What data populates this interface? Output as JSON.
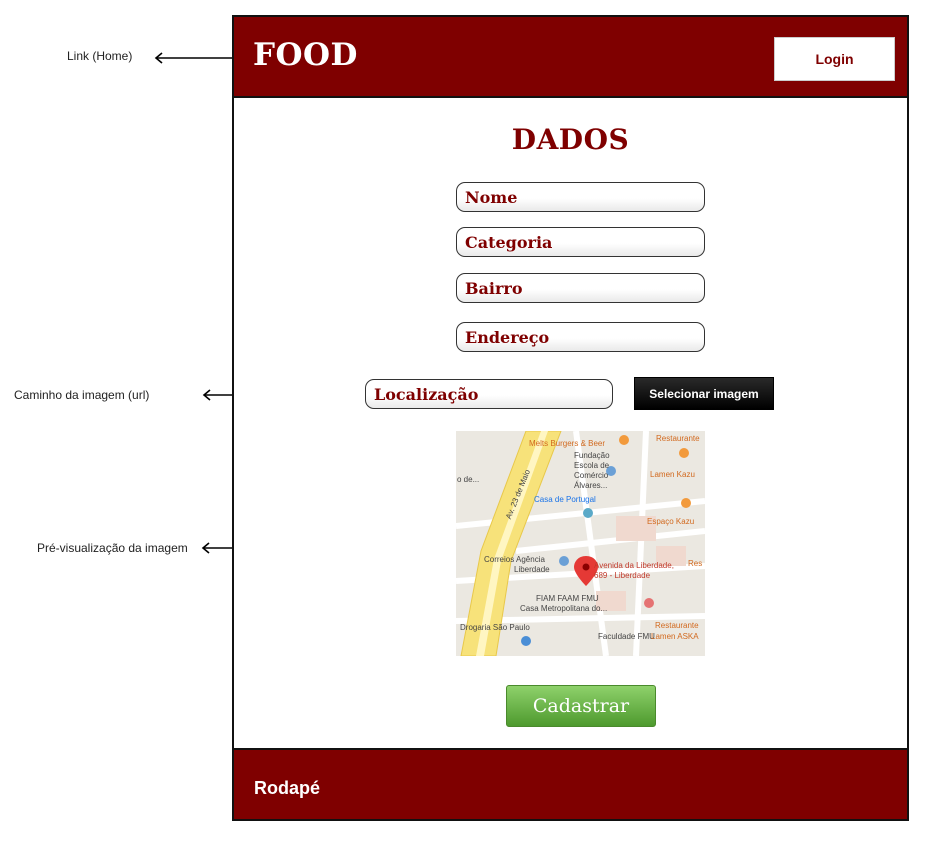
{
  "annotations": {
    "home_link": "Link (Home)",
    "image_path": "Caminho da imagem (url)",
    "image_preview": "Pré-visualização da imagem"
  },
  "header": {
    "brand": "FOOD",
    "login_label": "Login"
  },
  "form": {
    "title": "DADOS",
    "fields": {
      "nome": "Nome",
      "categoria": "Categoria",
      "bairro": "Bairro",
      "endereco": "Endereço",
      "localizacao": "Localização"
    },
    "select_image_label": "Selecionar imagem",
    "submit_label": "Cadastrar"
  },
  "map": {
    "labels": {
      "melts": "Melts Burgers & Beer",
      "restaurante_top": "Restaurante",
      "fundacao": "Fundação",
      "escola": "Escola de",
      "comercio": "Comércio",
      "alvares": "Álvares...",
      "lamen_kazu": "Lamen Kazu",
      "o_de": "o de...",
      "street": "Av. 23 de Maio",
      "casa_portugal": "Casa de Portugal",
      "espaco_kazu": "Espaço Kazu",
      "correios": "Correios Agência",
      "liberdade": "Liberdade",
      "pin_line1": "Avenida da Liberdade,",
      "pin_line2": "689 - Liberdade",
      "res_right": "Res",
      "fiam": "FIAM FAAM FMU",
      "casa_metro": "Casa Metropolitana do...",
      "drogaria": "Drogaria São Paulo",
      "restaurante_bottom": "Restaurante",
      "faculdade": "Faculdade FMU",
      "lamen_aska": "Lamen ASKA"
    }
  },
  "footer": {
    "text": "Rodapé"
  },
  "colors": {
    "brand_red": "#7f0000",
    "button_green": "#5cab3a",
    "button_dark": "#000000"
  }
}
